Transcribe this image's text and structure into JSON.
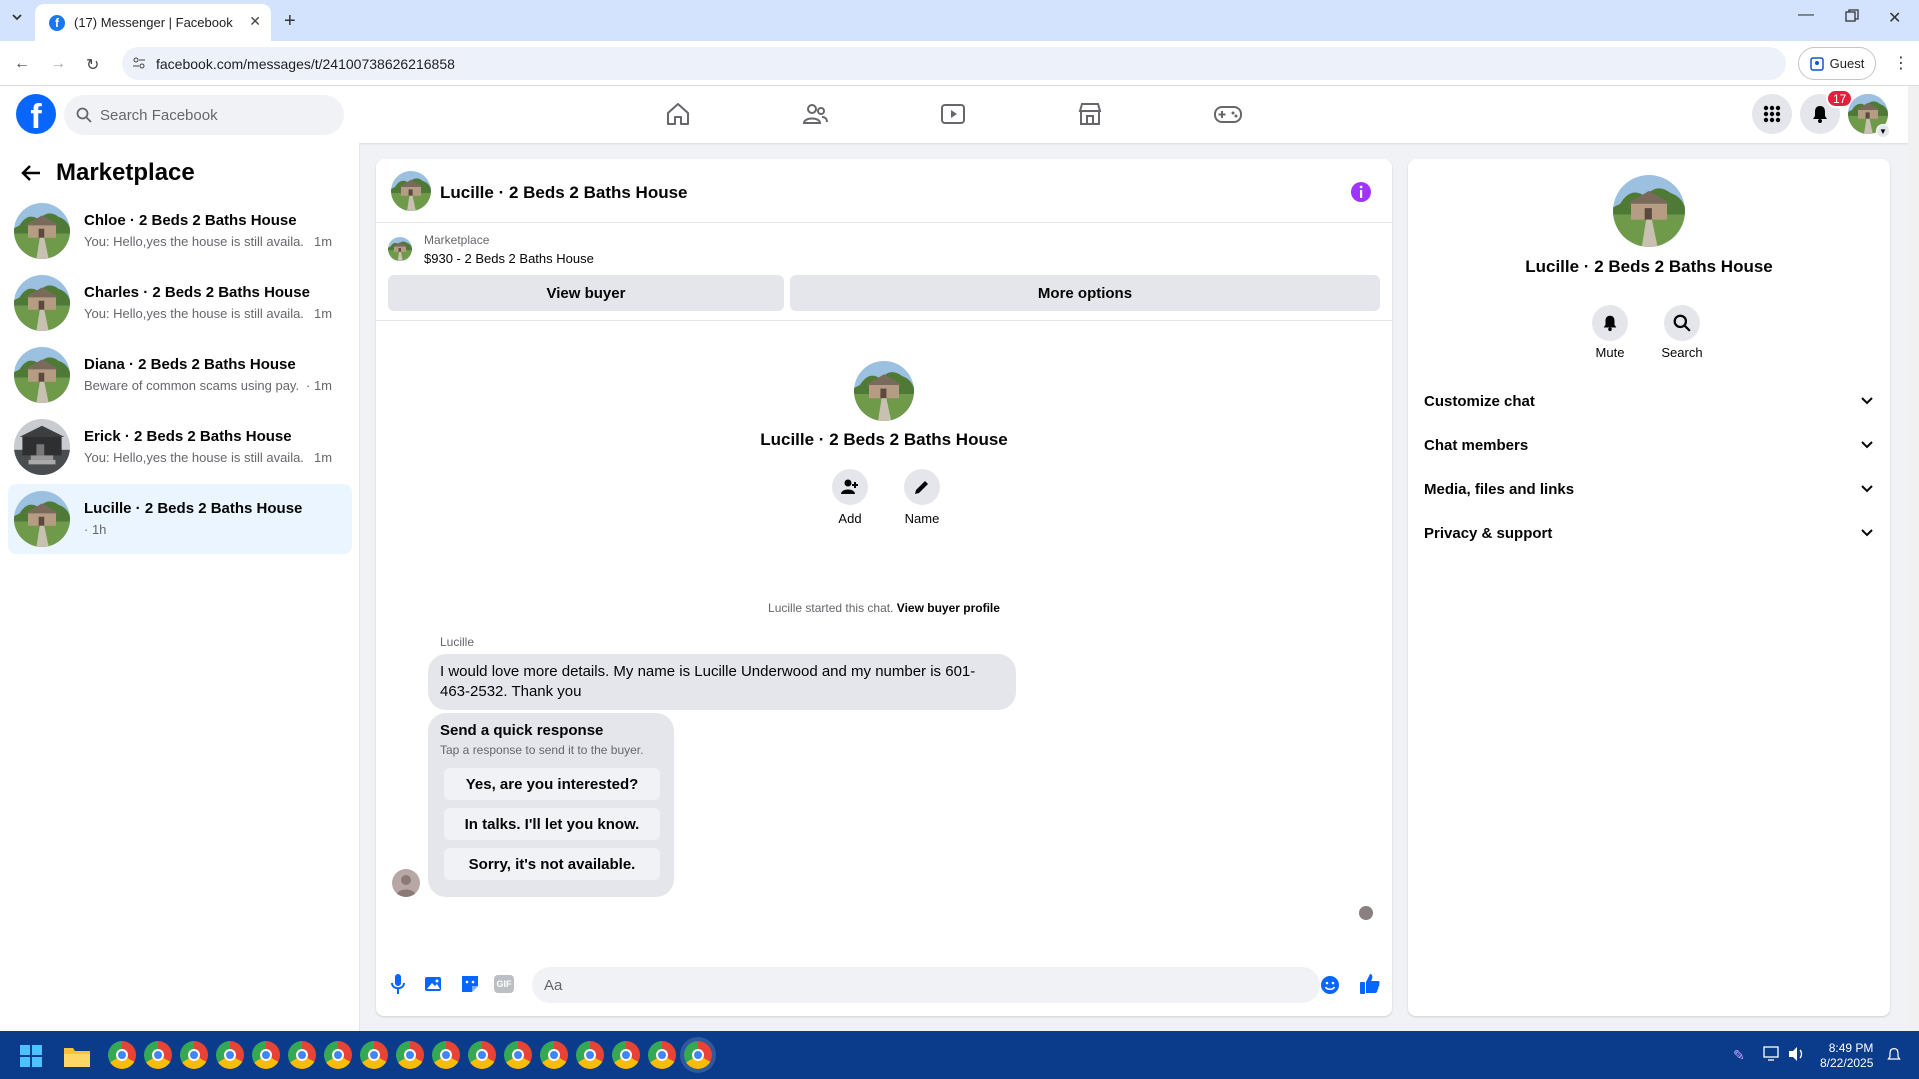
{
  "browser": {
    "tab_title": "(17) Messenger | Facebook",
    "url": "facebook.com/messages/t/24100738626216858",
    "guest_label": "Guest"
  },
  "fb": {
    "search_placeholder": "Search Facebook",
    "notification_count": "17",
    "nav_icons": [
      "home-icon",
      "friends-icon",
      "video-icon",
      "marketplace-icon",
      "gaming-icon"
    ]
  },
  "left": {
    "title": "Marketplace",
    "conversations": [
      {
        "name": "Chloe · 2 Beds 2 Baths House",
        "snippet": "You: Hello,yes the house is still availa...",
        "time": "1m"
      },
      {
        "name": "Charles · 2 Beds 2 Baths House",
        "snippet": "You: Hello,yes the house is still availa...",
        "time": "1m"
      },
      {
        "name": "Diana · 2 Beds 2 Baths House",
        "snippet": "Beware of common scams using pay...",
        "time": "· 1m"
      },
      {
        "name": "Erick · 2 Beds 2 Baths House",
        "snippet": "You: Hello,yes the house is still availa...",
        "time": "1m"
      },
      {
        "name": "Lucille · 2 Beds 2 Baths House",
        "snippet": "· 1h",
        "time": ""
      }
    ]
  },
  "chat": {
    "title": "Lucille · 2 Beds 2 Baths House",
    "marketplace_label": "Marketplace",
    "item": "$930 - 2 Beds 2 Baths House",
    "view_buyer": "View buyer",
    "more_options": "More options",
    "center_name": "Lucille · 2 Beds 2 Baths House",
    "add_label": "Add",
    "name_label": "Name",
    "started_text": "Lucille started this chat.",
    "view_profile": "View buyer profile",
    "sender": "Lucille",
    "message": "I would love more details.  My name is Lucille Underwood and my number is 601-463-2532. Thank you",
    "quick_title": "Send a quick response",
    "quick_sub": "Tap a response to send it to the buyer.",
    "quick_replies": [
      "Yes, are you interested?",
      "In talks. I'll let you know.",
      "Sorry, it's not available."
    ],
    "input_placeholder": "Aa"
  },
  "right": {
    "name": "Lucille · 2 Beds 2 Baths House",
    "mute": "Mute",
    "search": "Search",
    "sections": [
      "Customize chat",
      "Chat members",
      "Media, files and links",
      "Privacy & support"
    ]
  },
  "taskbar": {
    "time": "8:49 PM",
    "date": "8/22/2025"
  },
  "colors": {
    "accent": "#0866ff",
    "info_purple": "#a033ff",
    "taskbar": "#0b3c8c"
  }
}
